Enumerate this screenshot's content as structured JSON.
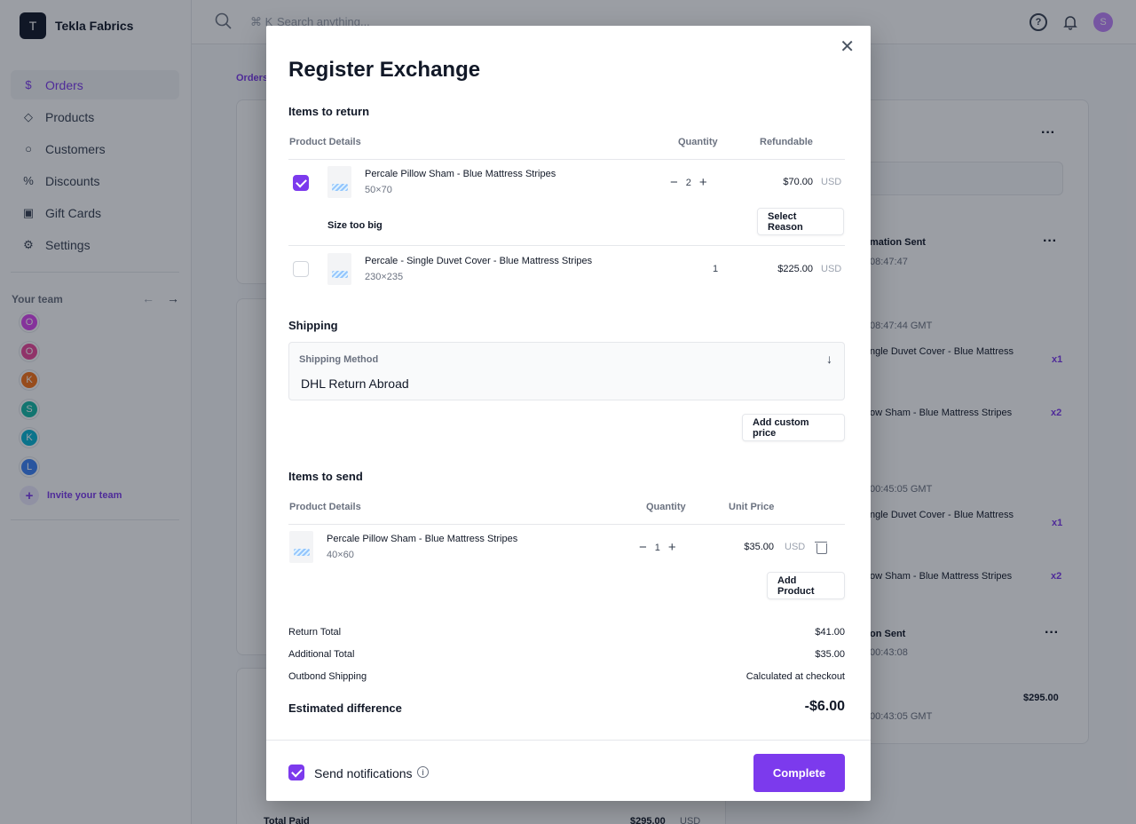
{
  "app": {
    "brand_initial": "T",
    "brand_name": "Tekla Fabrics"
  },
  "sidebar": {
    "items": [
      {
        "label": "Orders",
        "icon": "$"
      },
      {
        "label": "Products",
        "icon": "◇"
      },
      {
        "label": "Customers",
        "icon": "○"
      },
      {
        "label": "Discounts",
        "icon": "%"
      },
      {
        "label": "Gift Cards",
        "icon": "▣"
      },
      {
        "label": "Settings",
        "icon": "⚙"
      }
    ],
    "team_label": "Your team",
    "team_members": [
      {
        "initial": "O",
        "color": "#d946ef"
      },
      {
        "initial": "O",
        "color": "#ec4899"
      },
      {
        "initial": "K",
        "color": "#f97316"
      },
      {
        "initial": "S",
        "color": "#14b8a6"
      },
      {
        "initial": "K",
        "color": "#06b6d4"
      },
      {
        "initial": "L",
        "color": "#3b82f6"
      }
    ],
    "invite_label": "Invite your team"
  },
  "topbar": {
    "search_shortcut": "⌘ K",
    "search_placeholder": "Search anything...",
    "user_initial": "S"
  },
  "background": {
    "breadcrumb": "Orders",
    "timeline": [
      {
        "text": "mation Sent",
        "bold": true
      },
      {
        "text": "08:47:47"
      },
      {
        "text": "08:47:44 GMT"
      },
      {
        "text": "ngle Duvet Cover - Blue Mattress",
        "qty": "x1"
      },
      {
        "text": "ow Sham - Blue Mattress Stripes",
        "qty": "x2"
      },
      {
        "text": "00:45:05 GMT"
      },
      {
        "text": "ngle Duvet Cover - Blue Mattress",
        "qty": "x1"
      },
      {
        "text": "ow Sham - Blue Mattress Stripes",
        "qty": "x2"
      },
      {
        "text": "on Sent",
        "bold": true
      },
      {
        "text": "00:43:08"
      },
      {
        "text": "$295.00",
        "bold": true
      },
      {
        "text": "00:43:05 GMT"
      }
    ],
    "total_paid_label": "Total Paid",
    "total_paid_value": "$295.00",
    "total_paid_currency": "USD"
  },
  "modal": {
    "title": "Register Exchange",
    "return_section": {
      "title": "Items to return",
      "col_product": "Product Details",
      "col_quantity": "Quantity",
      "col_refundable": "Refundable",
      "items": [
        {
          "name": "Percale Pillow Sham - Blue Mattress Stripes",
          "size": "50×70",
          "quantity": "2",
          "price": "$70.00",
          "currency": "USD",
          "checked": true,
          "reason": "Size too big",
          "reason_button": "Select Reason"
        },
        {
          "name": "Percale - Single Duvet Cover - Blue Mattress Stripes",
          "size": "230×235",
          "quantity": "1",
          "price": "$225.00",
          "currency": "USD",
          "checked": false
        }
      ]
    },
    "shipping_section": {
      "title": "Shipping",
      "method_label": "Shipping Method",
      "method_value": "DHL Return Abroad",
      "custom_price_button": "Add custom price"
    },
    "send_section": {
      "title": "Items to send",
      "col_product": "Product Details",
      "col_quantity": "Quantity",
      "col_unit_price": "Unit Price",
      "items": [
        {
          "name": "Percale Pillow Sham - Blue Mattress Stripes",
          "size": "40×60",
          "quantity": "1",
          "price": "$35.00",
          "currency": "USD"
        }
      ],
      "add_product_button": "Add Product"
    },
    "summary": {
      "return_total_label": "Return Total",
      "return_total_value": "$41.00",
      "additional_total_label": "Additional Total",
      "additional_total_value": "$35.00",
      "outbound_label": "Outbond Shipping",
      "outbound_value": "Calculated at checkout",
      "estimated_label": "Estimated difference",
      "estimated_value": "-$6.00"
    },
    "footer": {
      "notifications_label": "Send notifications",
      "notifications_checked": true,
      "complete_button": "Complete"
    }
  },
  "colors": {
    "accent": "#7c3aed",
    "overlay": "rgba(17,24,39,0.42)"
  }
}
